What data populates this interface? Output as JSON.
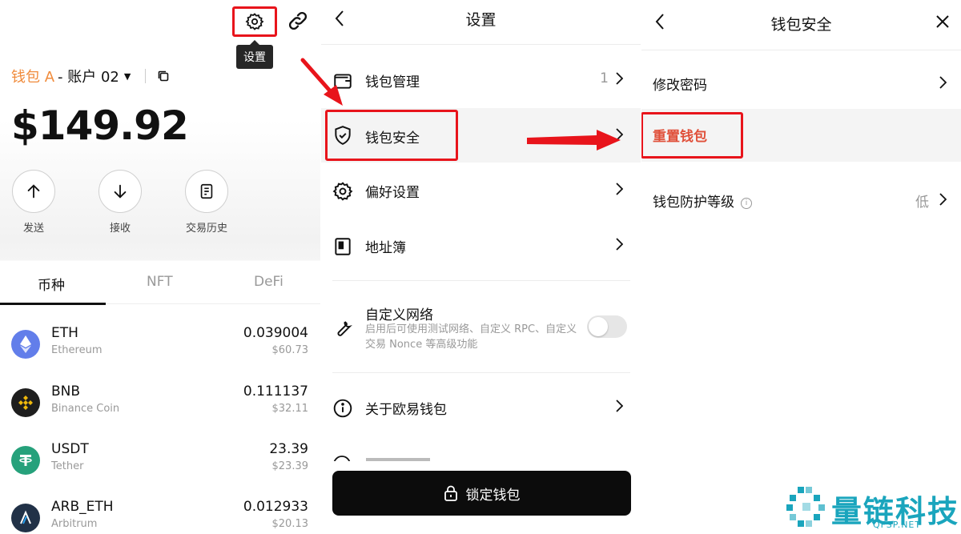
{
  "panel1": {
    "tooltip": "设置",
    "wallet_name": "钱包 A",
    "account_name": "- 账户 02",
    "balance": "$149.92",
    "actions": [
      {
        "label": "发送",
        "icon": "arrow-up-icon"
      },
      {
        "label": "接收",
        "icon": "arrow-down-icon"
      },
      {
        "label": "交易历史",
        "icon": "history-icon"
      }
    ],
    "tabs": [
      {
        "label": "币种",
        "active": true
      },
      {
        "label": "NFT",
        "active": false
      },
      {
        "label": "DeFi",
        "active": false
      }
    ],
    "tokens": [
      {
        "symbol": "ETH",
        "name": "Ethereum",
        "amount": "0.039004",
        "usd": "$60.73",
        "icon": "eth-icon",
        "color": "#627eea"
      },
      {
        "symbol": "BNB",
        "name": "Binance Coin",
        "amount": "0.111137",
        "usd": "$32.11",
        "icon": "bnb-icon",
        "color": "#1e1e1e"
      },
      {
        "symbol": "USDT",
        "name": "Tether",
        "amount": "23.39",
        "usd": "$23.39",
        "icon": "usdt-icon",
        "color": "#26a17b"
      },
      {
        "symbol": "ARB_ETH",
        "name": "Arbitrum",
        "amount": "0.012933",
        "usd": "$20.13",
        "icon": "arbitrum-icon",
        "color": "#213147"
      }
    ]
  },
  "panel2": {
    "title": "设置",
    "rows": [
      {
        "label": "钱包管理",
        "value": "1",
        "icon": "wallet-icon"
      },
      {
        "label": "钱包安全",
        "value": "",
        "icon": "shield-check-icon"
      },
      {
        "label": "偏好设置",
        "value": "",
        "icon": "gear-icon"
      },
      {
        "label": "地址簿",
        "value": "",
        "icon": "address-book-icon"
      }
    ],
    "custom_network": {
      "label": "自定义网络",
      "description": "启用后可使用测试网络、自定义 RPC、自定义交易 Nonce 等高级功能",
      "enabled": false
    },
    "about": {
      "label": "关于欧易钱包",
      "icon": "info-circle-icon"
    },
    "lock_button": "锁定钱包"
  },
  "panel3": {
    "title": "钱包安全",
    "rows": [
      {
        "label": "修改密码",
        "value": ""
      },
      {
        "label": "重置钱包",
        "value": ""
      },
      {
        "label": "钱包防护等级",
        "value": "低"
      }
    ]
  },
  "watermark": {
    "text": "量链科技",
    "sub": "QFSP.NET"
  },
  "colors": {
    "highlight_red": "#e8141b",
    "wallet_orange": "#f08b3b",
    "reset_red": "#e0503a",
    "watermark_teal": "#1aa5bd"
  }
}
